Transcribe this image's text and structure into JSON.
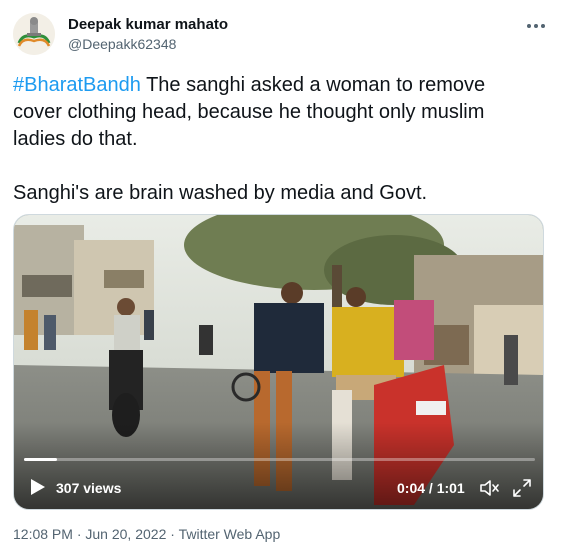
{
  "user": {
    "display_name": "Deepak kumar mahato",
    "handle": "@Deepakk62348",
    "avatar_icon": "emblem-avatar-icon"
  },
  "more_icon": "more-horizontal-icon",
  "tweet": {
    "hashtag": "#BharatBandh",
    "line1_rest": " The sanghi asked a woman to remove",
    "line2": "cover clothing head, because he thought only muslim",
    "line3": "ladies do that.",
    "line4": "Sanghi's are brain washed by media and Govt."
  },
  "video": {
    "views": "307 views",
    "timecode": "0:04 / 1:01",
    "progress_percent": 6.5,
    "play_icon": "play-icon",
    "volume_icon": "volume-icon",
    "fullscreen_icon": "fullscreen-icon"
  },
  "meta": {
    "time": "12:08 PM",
    "sep1": " · ",
    "date": "Jun 20, 2022",
    "sep2": " · ",
    "source": "Twitter Web App"
  },
  "colors": {
    "link": "#1d9bf0",
    "secondary_text": "#536471",
    "primary_text": "#0f1419"
  }
}
